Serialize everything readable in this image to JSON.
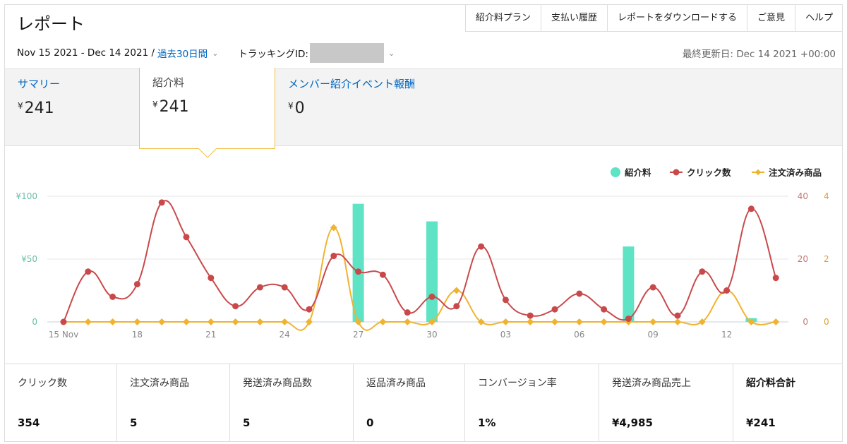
{
  "page": {
    "title": "レポート"
  },
  "topnav": [
    "紹介料プラン",
    "支払い履歴",
    "レポートをダウンロードする",
    "ご意見",
    "ヘルプ"
  ],
  "subbar": {
    "date_range": "Nov 15 2021 - Dec 14 2021 /",
    "range_link": "過去30日間",
    "tracking_label": "トラッキングID:",
    "updated": "最終更新日: Dec 14 2021 +00:00"
  },
  "tabs": [
    {
      "label": "サマリー",
      "currency": "¥",
      "value": "241"
    },
    {
      "label": "紹介料",
      "currency": "¥",
      "value": "241"
    },
    {
      "label": "メンバー紹介イベント報酬",
      "currency": "¥",
      "value": "0"
    }
  ],
  "colors": {
    "fee": "#5ee3c4",
    "clicks": "#c9494b",
    "orders": "#f0b330",
    "link": "#0066c0"
  },
  "chart_data": {
    "type": "bar",
    "legend": [
      "紹介料",
      "クリック数",
      "注文済み商品"
    ],
    "legend_position": "top-right",
    "x_ticks": [
      "15 Nov",
      "18",
      "21",
      "24",
      "27",
      "30",
      "03",
      "06",
      "09",
      "12"
    ],
    "y_left_ticks": [
      "¥100",
      "¥50",
      "0"
    ],
    "y_right1_ticks": [
      "40",
      "20",
      "0"
    ],
    "y_right2_ticks": [
      "4",
      "2",
      "0"
    ],
    "y_left_range": [
      0,
      100
    ],
    "y_right1_range": [
      0,
      40
    ],
    "y_right2_range": [
      0,
      4
    ],
    "dates": [
      "Nov 15",
      "Nov 16",
      "Nov 17",
      "Nov 18",
      "Nov 19",
      "Nov 20",
      "Nov 21",
      "Nov 22",
      "Nov 23",
      "Nov 24",
      "Nov 25",
      "Nov 26",
      "Nov 27",
      "Nov 28",
      "Nov 29",
      "Nov 30",
      "Dec 01",
      "Dec 02",
      "Dec 03",
      "Dec 04",
      "Dec 05",
      "Dec 06",
      "Dec 07",
      "Dec 08",
      "Dec 09",
      "Dec 10",
      "Dec 11",
      "Dec 12",
      "Dec 13",
      "Dec 14"
    ],
    "series": [
      {
        "name": "紹介料",
        "type": "bar",
        "values": [
          0,
          0,
          0,
          0,
          0,
          0,
          0,
          0,
          0,
          0,
          0,
          0,
          94,
          0,
          0,
          80,
          0,
          0,
          0,
          0,
          0,
          0,
          0,
          60,
          0,
          0,
          0,
          0,
          3,
          0
        ]
      },
      {
        "name": "クリック数",
        "type": "line",
        "values": [
          0,
          16,
          8,
          12,
          38,
          27,
          14,
          5,
          11,
          11,
          4,
          21,
          16,
          15,
          3,
          8,
          5,
          24,
          7,
          2,
          4,
          9,
          4,
          1,
          11,
          2,
          16,
          10,
          36,
          14
        ]
      },
      {
        "name": "注文済み商品",
        "type": "line",
        "values": [
          0,
          0,
          0,
          0,
          0,
          0,
          0,
          0,
          0,
          0,
          0,
          3,
          0,
          0,
          0,
          0,
          1,
          0,
          0,
          0,
          0,
          0,
          0,
          0,
          0,
          0,
          0,
          1,
          0,
          0
        ]
      }
    ],
    "grid": true
  },
  "stats": [
    {
      "label": "クリック数",
      "value": "354"
    },
    {
      "label": "注文済み商品",
      "value": "5"
    },
    {
      "label": "発送済み商品数",
      "value": "5"
    },
    {
      "label": "返品済み商品",
      "value": "0"
    },
    {
      "label": "コンバージョン率",
      "value": "1%"
    },
    {
      "label": "発送済み商品売上",
      "value": "¥4,985"
    },
    {
      "label": "紹介料合計",
      "value": "¥241"
    }
  ]
}
